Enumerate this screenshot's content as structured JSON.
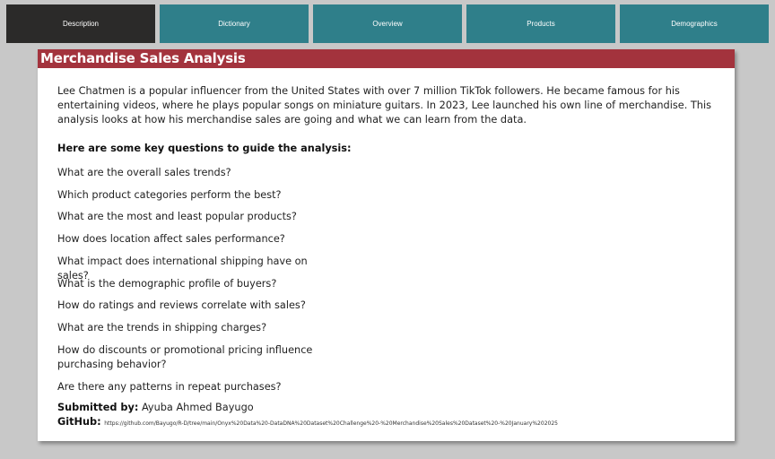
{
  "nav": {
    "tabs": [
      {
        "label": "Description",
        "active": true
      },
      {
        "label": "Dictionary",
        "active": false
      },
      {
        "label": "Overview",
        "active": false
      },
      {
        "label": "Products",
        "active": false
      },
      {
        "label": "Demographics",
        "active": false
      }
    ]
  },
  "colors": {
    "active_tab": "#2b2a29",
    "inactive_tab": "#2f7f8a",
    "title_bar": "#a3333d",
    "background": "#c8c8c8"
  },
  "card": {
    "title": "Merchandise Sales Analysis",
    "intro": "Lee Chatmen is a popular influencer from the United States with over 7 million TikTok followers. He became famous for his entertaining videos, where he plays popular songs on miniature guitars. In 2023, Lee launched his own line of merchandise. This analysis looks at how his merchandise sales are going and what we can learn from the data.",
    "questions_heading": "Here are some key questions to guide the analysis:",
    "questions": [
      "What are the overall sales trends?",
      "Which product categories perform the best?",
      "What are the most and least popular products?",
      "How does location affect sales performance?",
      "What impact does international shipping have on sales?",
      "What is the demographic profile of buyers?",
      "How do ratings and reviews correlate with sales?",
      "What are the trends in shipping charges?",
      "How do discounts or promotional pricing influence purchasing behavior?",
      "Are there any patterns in repeat purchases?"
    ],
    "submitted_label": "Submitted by:",
    "submitted_name": "Ayuba Ahmed Bayugo",
    "github_label": "GitHub:",
    "github_url": "https://github.com/Bayugo/R-D/tree/main/Onyx%20Data%20-DataDNA%20Dataset%20Challenge%20-%20Merchandise%20Sales%20Dataset%20-%20January%202025"
  }
}
